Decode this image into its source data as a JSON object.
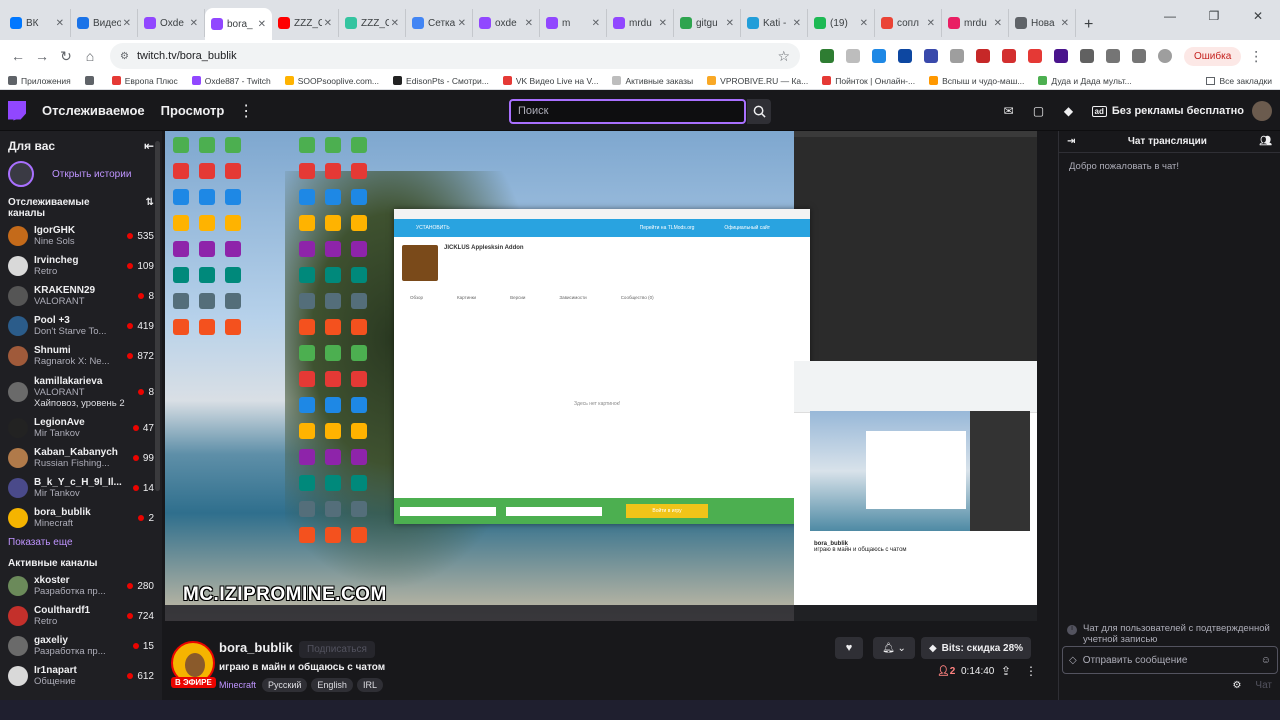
{
  "browser": {
    "tabs": [
      {
        "label": "ВК",
        "color": "#0077ff"
      },
      {
        "label": "Видео",
        "color": "#1a73e8"
      },
      {
        "label": "Oxde",
        "color": "#9147ff"
      },
      {
        "label": "bora_",
        "color": "#9147ff",
        "active": true
      },
      {
        "label": "ZZZ_C",
        "color": "#ff0000"
      },
      {
        "label": "ZZZ_C",
        "color": "#34c4a0"
      },
      {
        "label": "Сетка",
        "color": "#4285f4"
      },
      {
        "label": "oxde",
        "color": "#9147ff"
      },
      {
        "label": "m",
        "color": "#9147ff"
      },
      {
        "label": "mrdu",
        "color": "#9147ff"
      },
      {
        "label": "gitgu",
        "color": "#2ea44f"
      },
      {
        "label": "Kati -",
        "color": "#229ed9"
      },
      {
        "label": "(19)",
        "color": "#1db954"
      },
      {
        "label": "сопл",
        "color": "#ea4335"
      },
      {
        "label": "mrdu",
        "color": "#e91e63"
      },
      {
        "label": "Нова",
        "color": "#5f6368"
      }
    ],
    "url": "twitch.tv/bora_bublik",
    "error_label": "Ошибка",
    "bookmarks": [
      {
        "label": "Приложения",
        "color": "#5f6368"
      },
      {
        "label": "",
        "color": "#5f6368"
      },
      {
        "label": "Европа Плюс",
        "color": "#e53935"
      },
      {
        "label": "Oxde887 - Twitch",
        "color": "#9147ff"
      },
      {
        "label": "SOOPsooplive.com...",
        "color": "#ffb300"
      },
      {
        "label": "EdisonPts - Смотри...",
        "color": "#222"
      },
      {
        "label": "VK Видео Live на V...",
        "color": "#e53935"
      },
      {
        "label": "Активные заказы",
        "color": "#bdbdbd"
      },
      {
        "label": "VPROBIVE.RU — Ка...",
        "color": "#f9a825"
      },
      {
        "label": "Пойнток | Онлайн-...",
        "color": "#e53935"
      },
      {
        "label": "Вспыш и чудо-маш...",
        "color": "#ff9800"
      },
      {
        "label": "Дуда и Дада мульт...",
        "color": "#4caf50"
      }
    ],
    "all_bookmarks": "Все закладки"
  },
  "twitch_nav": {
    "following": "Отслеживаемое",
    "browse": "Просмотр",
    "search_placeholder": "Поиск",
    "ad_free": "Без рекламы бесплатно"
  },
  "sidebar": {
    "for_you": "Для вас",
    "open_stories": "Открыть истории",
    "followed_title": "Отслеживаемые каналы",
    "followed": [
      {
        "name": "IgorGHK",
        "game": "Nine Sols",
        "viewers": "535",
        "color": "#c46a1a"
      },
      {
        "name": "Irvincheg",
        "game": "Retro",
        "viewers": "109",
        "color": "#d9d9d9"
      },
      {
        "name": "KRAKENN29",
        "game": "VALORANT",
        "viewers": "8",
        "color": "#555"
      },
      {
        "name": "Pool +3",
        "game": "Don't Starve To...",
        "viewers": "419",
        "color": "#2b5c8a"
      },
      {
        "name": "Shnumi",
        "game": "Ragnarok X: Ne...",
        "viewers": "872",
        "color": "#a05a3a"
      },
      {
        "name": "kamillakarieva",
        "game": "VALORANT",
        "viewers": "8",
        "color": "#6a6a6a",
        "extra": "Хайповоз, уровень 2"
      },
      {
        "name": "LegionAve",
        "game": "Mir Tankov",
        "viewers": "47",
        "color": "#222"
      },
      {
        "name": "Kaban_Kabanych",
        "game": "Russian Fishing...",
        "viewers": "99",
        "color": "#b07a4a"
      },
      {
        "name": "B_k_Y_c_H_9l_Il...",
        "game": "Mir Tankov",
        "viewers": "14",
        "color": "#4a4a8a"
      },
      {
        "name": "bora_bublik",
        "game": "Minecraft",
        "viewers": "2",
        "color": "#f5b400"
      }
    ],
    "show_more": "Показать еще",
    "active_title": "Активные каналы",
    "active": [
      {
        "name": "xkoster",
        "game": "Разработка пр...",
        "viewers": "280",
        "color": "#6b8a5a"
      },
      {
        "name": "Coulthardf1",
        "game": "Retro",
        "viewers": "724",
        "color": "#c4302b"
      },
      {
        "name": "gaxeliy",
        "game": "Разработка пр...",
        "viewers": "15",
        "color": "#6a6a6a"
      },
      {
        "name": "Ir1napart",
        "game": "Общение",
        "viewers": "612",
        "color": "#d9d9d9"
      }
    ]
  },
  "video": {
    "watermark": "MC.IZIPROMINE.COM",
    "launcher": {
      "header": "УСТАНОВИТЬ",
      "header_link_1": "Перейти на TLMods.org",
      "header_link_2": "Официальный сайт",
      "mod_title": "JICKLUS Applesksin Addon",
      "tabs": [
        "Обзор",
        "Картинки",
        "Версии",
        "Зависимости",
        "Сообщество (0)"
      ],
      "empty": "Здесь нет картинок!",
      "play": "Войти в игру"
    },
    "nested": {
      "name": "bora_bublik",
      "title": "играю в майн и общаюсь с чатом"
    }
  },
  "stream": {
    "streamer": "bora_bublik",
    "follow": "Подписаться",
    "live": "В ЭФИРЕ",
    "title": "играю в майн и общаюсь с чатом",
    "game": "Minecraft",
    "tags": [
      "Русский",
      "English",
      "IRL"
    ],
    "bits": "Bits: скидка 28%",
    "viewers": "2",
    "uptime": "0:14:40"
  },
  "chat": {
    "title": "Чат трансляции",
    "welcome": "Добро пожаловать в чат!",
    "notice": "Чат для пользователей с подтвержденной учетной записью",
    "send_placeholder": "Отправить сообщение",
    "chat_button": "Чат"
  },
  "colors": {
    "twitch_purple": "#9147ff",
    "live_red": "#eb0400",
    "bg_dark": "#18181b"
  }
}
